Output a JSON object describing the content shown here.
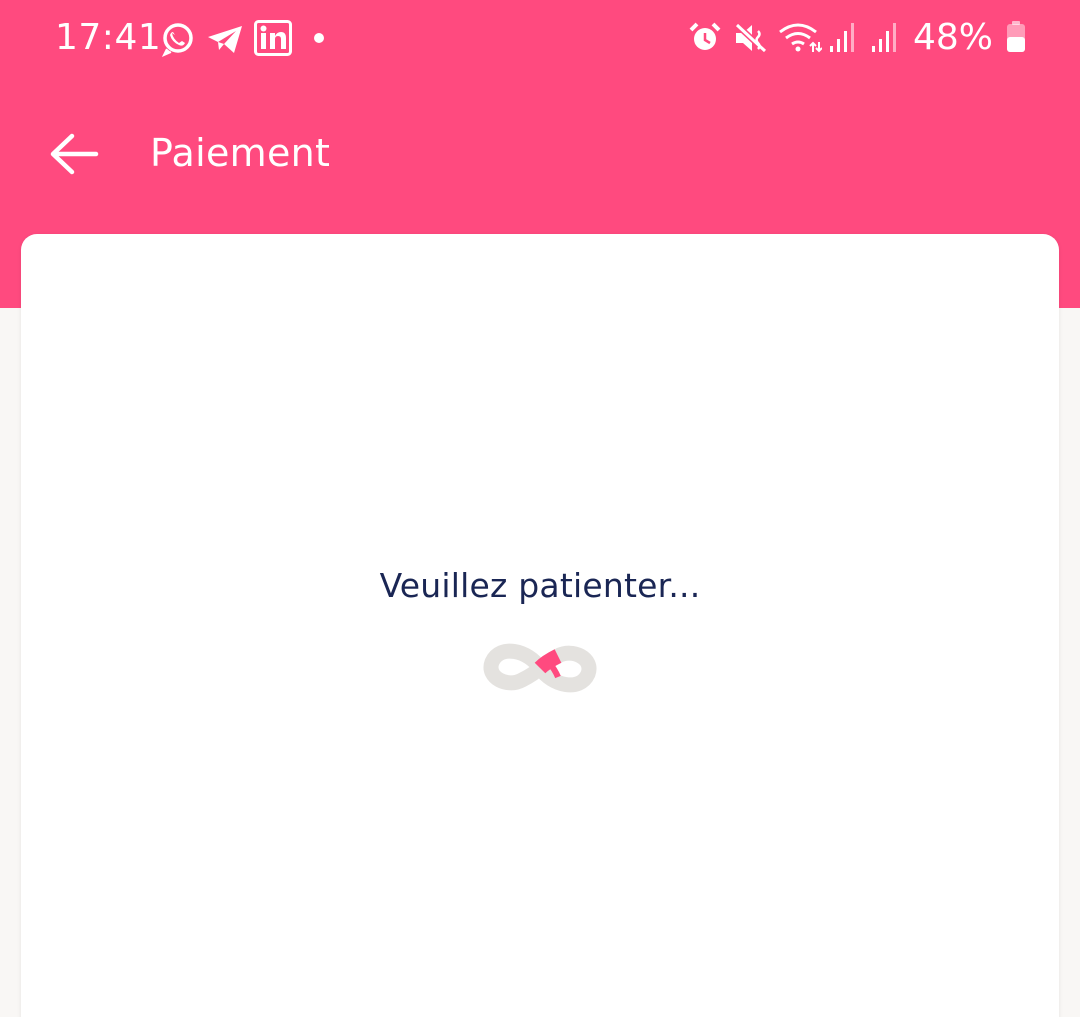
{
  "status_bar": {
    "time": "17:41",
    "notification_icons": [
      "whatsapp-icon",
      "telegram-icon",
      "linkedin-icon",
      "notification-dot-icon"
    ],
    "system_icons": [
      "alarm-icon",
      "mute-icon",
      "wifi-icon",
      "signal-icon",
      "signal-icon"
    ],
    "battery_percent": "48%"
  },
  "app_bar": {
    "title": "Paiement",
    "back_icon": "arrow-left-icon"
  },
  "card": {
    "loading_text": "Veuillez patienter...",
    "spinner_icon": "infinity-loader-icon"
  },
  "colors": {
    "header": "#ff4a7f",
    "card": "#ffffff",
    "page_background": "#f9f7f5",
    "text_primary": "#1a2654",
    "spinner_track": "#e4e2df",
    "spinner_accent": "#ff4a7f"
  }
}
